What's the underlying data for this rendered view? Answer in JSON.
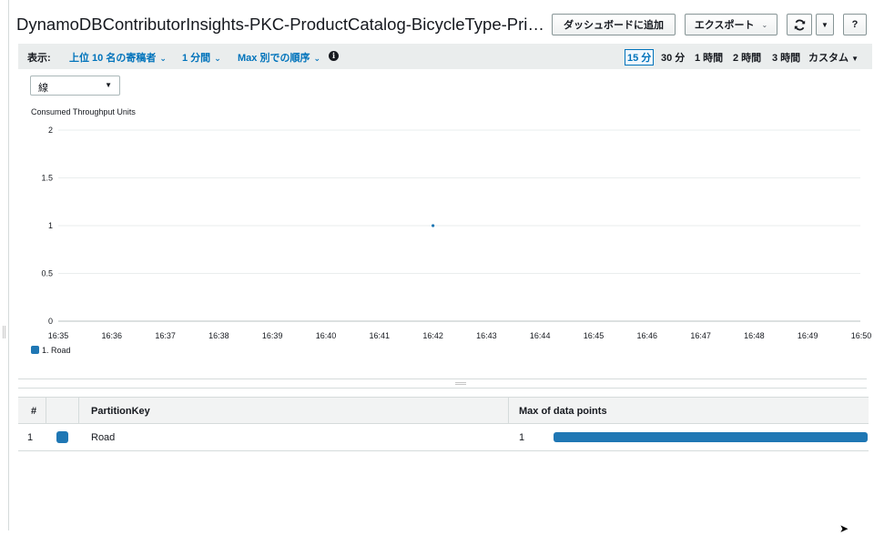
{
  "header": {
    "title": "DynamoDBContributorInsights-PKC-ProductCatalog-BicycleType-Price-in…",
    "add_to_dashboard": "ダッシュボードに追加",
    "export": "エクスポート",
    "help": "?"
  },
  "toolbar": {
    "display_label": "表示:",
    "top_contributors": "上位 10 名の寄稿者",
    "period": "1 分間",
    "order": "Max 別での順序",
    "ranges": [
      "15 分",
      "30 分",
      "1 時間",
      "2 時間",
      "3 時間",
      "カスタム"
    ],
    "active_range": "15 分"
  },
  "chart_select": {
    "value": "線"
  },
  "colors": {
    "series": "#1f77b4",
    "link": "#0073bb"
  },
  "chart_data": {
    "type": "line",
    "ylabel": "Consumed Throughput Units",
    "ylim": [
      0,
      2
    ],
    "yticks": [
      "2",
      "1.5",
      "1",
      "0.5",
      "0"
    ],
    "xticks": [
      "16:35",
      "16:36",
      "16:37",
      "16:38",
      "16:39",
      "16:40",
      "16:41",
      "16:42",
      "16:43",
      "16:44",
      "16:45",
      "16:46",
      "16:47",
      "16:48",
      "16:49",
      "16:50"
    ],
    "grid": true,
    "legend_position": "bottom-left",
    "series": [
      {
        "name": "1. Road",
        "points": [
          {
            "x": "16:42",
            "y": 1
          }
        ]
      }
    ]
  },
  "table": {
    "headers": {
      "index": "#",
      "partition_key": "PartitionKey",
      "max": "Max of data points"
    },
    "rows": [
      {
        "index": "1",
        "key": "Road",
        "max": "1",
        "bar_fraction": 1.0
      }
    ]
  }
}
